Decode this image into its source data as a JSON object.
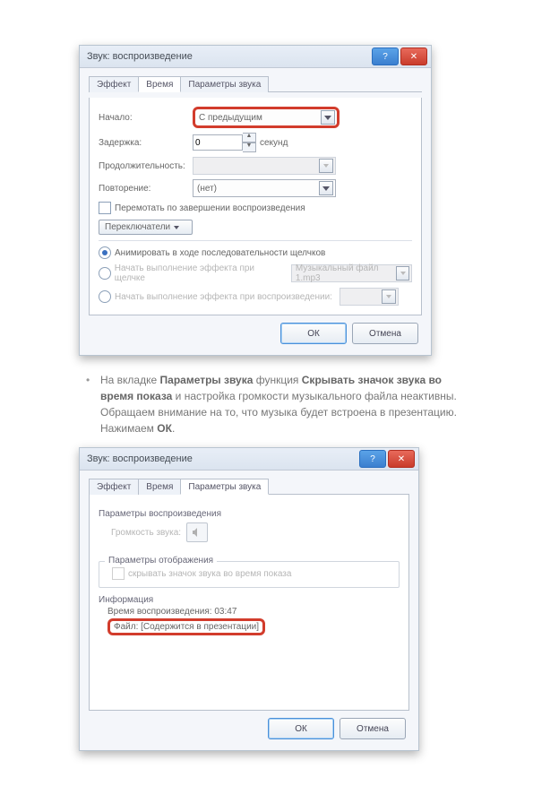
{
  "dlg1": {
    "title": "Звук: воспроизведение",
    "help": "?",
    "close": "✕",
    "tabs": {
      "t1": "Эффект",
      "t2": "Время",
      "t3": "Параметры звука"
    },
    "start_label": "Начало:",
    "start_value": "С предыдущим",
    "delay_label": "Задержка:",
    "delay_value": "0",
    "delay_unit": "секунд",
    "duration_label": "Продолжительность:",
    "repeat_label": "Повторение:",
    "repeat_value": "(нет)",
    "rewind": "Перемотать по завершении воспроизведения",
    "switches": "Переключатели",
    "r1": "Анимировать в ходе последовательности щелчков",
    "r2": "Начать выполнение эффекта при щелчке",
    "r2_combo": "Музыкальный файл 1.mp3",
    "r3": "Начать выполнение эффекта при воспроизведении:",
    "ok": "ОК",
    "cancel": "Отмена"
  },
  "para": {
    "t1": "На вкладке ",
    "b1": "Параметры звука",
    "t2": " функция ",
    "b2": "Скрывать значок звука во время показа",
    "t3": " и настройка громкости музыкального файла неактивны. Обращаем внимание на то, что музыка будет встроена в презентацию. Нажимаем ",
    "b3": "ОК",
    "t4": "."
  },
  "dlg2": {
    "title": "Звук: воспроизведение",
    "help": "?",
    "close": "✕",
    "tabs": {
      "t1": "Эффект",
      "t2": "Время",
      "t3": "Параметры звука"
    },
    "grp1": "Параметры воспроизведения",
    "vol_label": "Громкость звука:",
    "grp2": "Параметры отображения",
    "hide": "скрывать значок звука во время показа",
    "grp3": "Информация",
    "playtime": "Время воспроизведения:  03:47",
    "file": "Файл:  [Содержится в презентации]",
    "ok": "ОК",
    "cancel": "Отмена"
  }
}
